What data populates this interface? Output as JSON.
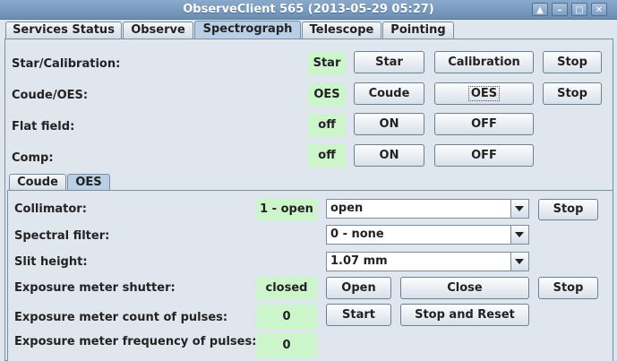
{
  "window": {
    "title": "ObserveClient 565 (2013-05-29 05:27)",
    "buttons": [
      "▲",
      "–",
      "□",
      "✕"
    ]
  },
  "tabs": [
    "Services Status",
    "Observe",
    "Spectrograph",
    "Telescope",
    "Pointing"
  ],
  "selected_tab": "Spectrograph",
  "top_rows": [
    {
      "label": "Star/Calibration:",
      "status": "Star",
      "b1": "Star",
      "b2": "Calibration",
      "b3": "Stop"
    },
    {
      "label": "Coude/OES:",
      "status": "OES",
      "b1": "Coude",
      "b2": "OES",
      "b3": "Stop"
    },
    {
      "label": "Flat field:",
      "status": "off",
      "b1": "ON",
      "b2": "OFF"
    },
    {
      "label": "Comp:",
      "status": "off",
      "b1": "ON",
      "b2": "OFF"
    }
  ],
  "subtabs": [
    "Coude",
    "OES"
  ],
  "selected_subtab": "OES",
  "oes": {
    "collimator": {
      "label": "Collimator:",
      "status": "1 - open",
      "value": "open",
      "stop": "Stop"
    },
    "spectral_filter": {
      "label": "Spectral filter:",
      "value": "0 - none"
    },
    "slit_height": {
      "label": "Slit height:",
      "value": "1.07 mm"
    },
    "shutter": {
      "label": "Exposure meter shutter:",
      "status": "closed",
      "open": "Open",
      "close": "Close",
      "stop": "Stop"
    },
    "count": {
      "label": "Exposure meter count of pulses:",
      "value": "0",
      "start": "Start",
      "reset": "Stop and Reset"
    },
    "frequency": {
      "label": "Exposure meter frequency of pulses:",
      "value": "0"
    }
  }
}
